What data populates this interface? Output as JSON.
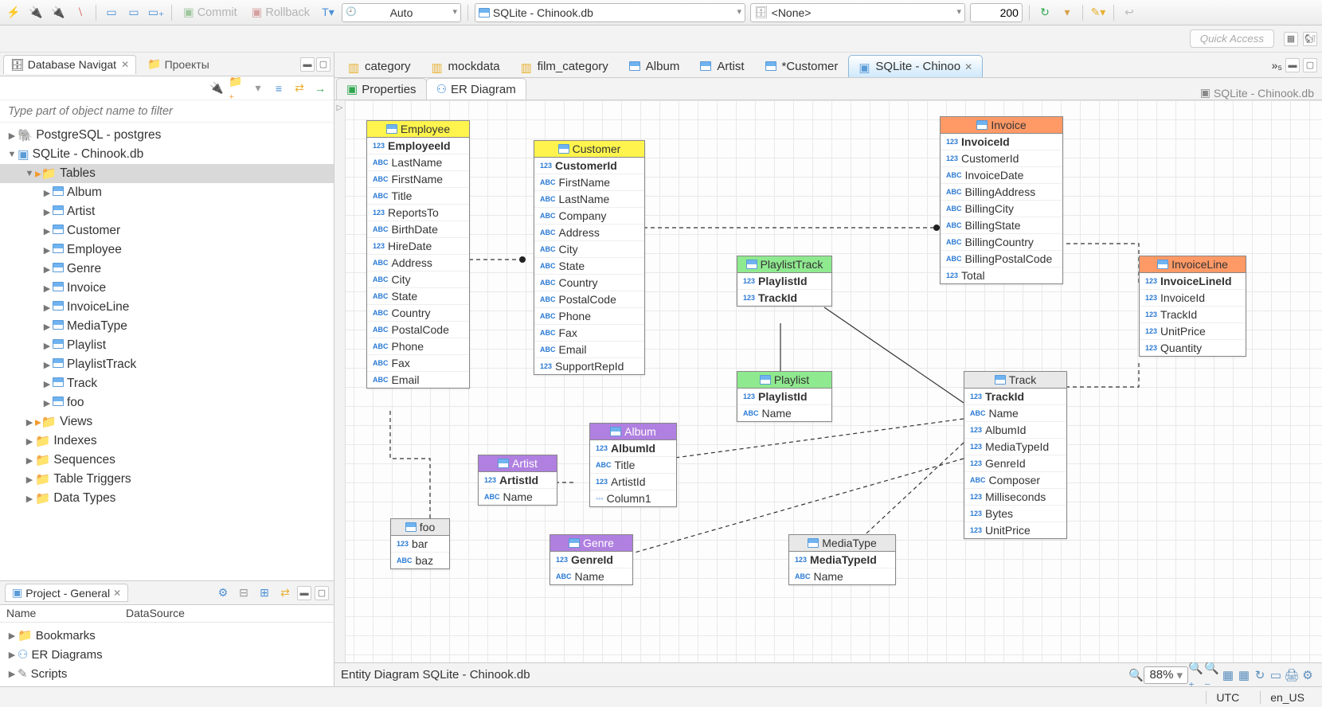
{
  "toolbar": {
    "commit_label": "Commit",
    "rollback_label": "Rollback",
    "mode_label": "Auto",
    "conn1": "SQLite - Chinook.db",
    "conn2": "<None>",
    "rows": "200"
  },
  "quick_access": "Quick Access",
  "nav": {
    "tab1": "Database Navigat",
    "tab2": "Проекты",
    "filter_placeholder": "Type part of object name to filter",
    "tree": [
      {
        "d": 0,
        "exp": "▶",
        "icon": "pg",
        "label": "PostgreSQL - postgres"
      },
      {
        "d": 0,
        "exp": "▼",
        "icon": "sqlite",
        "label": "SQLite - Chinook.db"
      },
      {
        "d": 1,
        "exp": "▼",
        "icon": "folder-o",
        "label": "Tables",
        "selected": true
      },
      {
        "d": 2,
        "exp": "▶",
        "icon": "table",
        "label": "Album"
      },
      {
        "d": 2,
        "exp": "▶",
        "icon": "table",
        "label": "Artist"
      },
      {
        "d": 2,
        "exp": "▶",
        "icon": "table",
        "label": "Customer"
      },
      {
        "d": 2,
        "exp": "▶",
        "icon": "table",
        "label": "Employee"
      },
      {
        "d": 2,
        "exp": "▶",
        "icon": "table",
        "label": "Genre"
      },
      {
        "d": 2,
        "exp": "▶",
        "icon": "table",
        "label": "Invoice"
      },
      {
        "d": 2,
        "exp": "▶",
        "icon": "table",
        "label": "InvoiceLine"
      },
      {
        "d": 2,
        "exp": "▶",
        "icon": "table",
        "label": "MediaType"
      },
      {
        "d": 2,
        "exp": "▶",
        "icon": "table",
        "label": "Playlist"
      },
      {
        "d": 2,
        "exp": "▶",
        "icon": "table",
        "label": "PlaylistTrack"
      },
      {
        "d": 2,
        "exp": "▶",
        "icon": "table",
        "label": "Track"
      },
      {
        "d": 2,
        "exp": "▶",
        "icon": "table",
        "label": "foo"
      },
      {
        "d": 1,
        "exp": "▶",
        "icon": "folder-o",
        "label": "Views"
      },
      {
        "d": 1,
        "exp": "▶",
        "icon": "folder",
        "label": "Indexes"
      },
      {
        "d": 1,
        "exp": "▶",
        "icon": "folder",
        "label": "Sequences"
      },
      {
        "d": 1,
        "exp": "▶",
        "icon": "folder",
        "label": "Table Triggers"
      },
      {
        "d": 1,
        "exp": "▶",
        "icon": "folder",
        "label": "Data Types"
      }
    ]
  },
  "project": {
    "title": "Project - General",
    "col1": "Name",
    "col2": "DataSource",
    "items": [
      {
        "exp": "▶",
        "icon": "folder",
        "label": "Bookmarks"
      },
      {
        "exp": "▶",
        "icon": "er",
        "label": "ER Diagrams"
      },
      {
        "exp": "▶",
        "icon": "scripts",
        "label": "Scripts"
      }
    ]
  },
  "editor": {
    "tabs": [
      {
        "icon": "col",
        "label": "category"
      },
      {
        "icon": "col",
        "label": "mockdata"
      },
      {
        "icon": "col",
        "label": "film_category"
      },
      {
        "icon": "table",
        "label": "Album"
      },
      {
        "icon": "table",
        "label": "Artist"
      },
      {
        "icon": "table",
        "label": "*Customer"
      },
      {
        "icon": "sqlite",
        "label": "SQLite - Chinoo",
        "active": true
      }
    ],
    "more_tabs": "»₅",
    "sub_properties": "Properties",
    "sub_er": "ER Diagram",
    "crumb": "SQLite - Chinook.db"
  },
  "entities": {
    "employee": {
      "title": "Employee",
      "cols": [
        {
          "t": "num",
          "n": "EmployeeId",
          "pk": true
        },
        {
          "t": "abc",
          "n": "LastName"
        },
        {
          "t": "abc",
          "n": "FirstName"
        },
        {
          "t": "abc",
          "n": "Title"
        },
        {
          "t": "num",
          "n": "ReportsTo"
        },
        {
          "t": "abc",
          "n": "BirthDate"
        },
        {
          "t": "num",
          "n": "HireDate"
        },
        {
          "t": "abc",
          "n": "Address"
        },
        {
          "t": "abc",
          "n": "City"
        },
        {
          "t": "abc",
          "n": "State"
        },
        {
          "t": "abc",
          "n": "Country"
        },
        {
          "t": "abc",
          "n": "PostalCode"
        },
        {
          "t": "abc",
          "n": "Phone"
        },
        {
          "t": "abc",
          "n": "Fax"
        },
        {
          "t": "abc",
          "n": "Email"
        }
      ]
    },
    "customer": {
      "title": "Customer",
      "cols": [
        {
          "t": "num",
          "n": "CustomerId",
          "pk": true
        },
        {
          "t": "abc",
          "n": "FirstName"
        },
        {
          "t": "abc",
          "n": "LastName"
        },
        {
          "t": "abc",
          "n": "Company"
        },
        {
          "t": "abc",
          "n": "Address"
        },
        {
          "t": "abc",
          "n": "City"
        },
        {
          "t": "abc",
          "n": "State"
        },
        {
          "t": "abc",
          "n": "Country"
        },
        {
          "t": "abc",
          "n": "PostalCode"
        },
        {
          "t": "abc",
          "n": "Phone"
        },
        {
          "t": "abc",
          "n": "Fax"
        },
        {
          "t": "abc",
          "n": "Email"
        },
        {
          "t": "num",
          "n": "SupportRepId"
        }
      ]
    },
    "invoice": {
      "title": "Invoice",
      "cols": [
        {
          "t": "num",
          "n": "InvoiceId",
          "pk": true
        },
        {
          "t": "num",
          "n": "CustomerId"
        },
        {
          "t": "abc",
          "n": "InvoiceDate"
        },
        {
          "t": "abc",
          "n": "BillingAddress"
        },
        {
          "t": "abc",
          "n": "BillingCity"
        },
        {
          "t": "abc",
          "n": "BillingState"
        },
        {
          "t": "abc",
          "n": "BillingCountry"
        },
        {
          "t": "abc",
          "n": "BillingPostalCode"
        },
        {
          "t": "num",
          "n": "Total"
        }
      ]
    },
    "invoiceline": {
      "title": "InvoiceLine",
      "cols": [
        {
          "t": "num",
          "n": "InvoiceLineId",
          "pk": true
        },
        {
          "t": "num",
          "n": "InvoiceId"
        },
        {
          "t": "num",
          "n": "TrackId"
        },
        {
          "t": "num",
          "n": "UnitPrice"
        },
        {
          "t": "num",
          "n": "Quantity"
        }
      ]
    },
    "playlisttrack": {
      "title": "PlaylistTrack",
      "cols": [
        {
          "t": "num",
          "n": "PlaylistId",
          "pk": true
        },
        {
          "t": "num",
          "n": "TrackId",
          "pk": true
        }
      ]
    },
    "playlist": {
      "title": "Playlist",
      "cols": [
        {
          "t": "num",
          "n": "PlaylistId",
          "pk": true
        },
        {
          "t": "abc",
          "n": "Name"
        }
      ]
    },
    "track": {
      "title": "Track",
      "cols": [
        {
          "t": "num",
          "n": "TrackId",
          "pk": true
        },
        {
          "t": "abc",
          "n": "Name"
        },
        {
          "t": "num",
          "n": "AlbumId"
        },
        {
          "t": "num",
          "n": "MediaTypeId"
        },
        {
          "t": "num",
          "n": "GenreId"
        },
        {
          "t": "abc",
          "n": "Composer"
        },
        {
          "t": "num",
          "n": "Milliseconds"
        },
        {
          "t": "num",
          "n": "Bytes"
        },
        {
          "t": "num",
          "n": "UnitPrice"
        }
      ]
    },
    "album": {
      "title": "Album",
      "cols": [
        {
          "t": "num",
          "n": "AlbumId",
          "pk": true
        },
        {
          "t": "abc",
          "n": "Title"
        },
        {
          "t": "num",
          "n": "ArtistId"
        },
        {
          "t": "oth",
          "n": "Column1"
        }
      ]
    },
    "artist": {
      "title": "Artist",
      "cols": [
        {
          "t": "num",
          "n": "ArtistId",
          "pk": true
        },
        {
          "t": "abc",
          "n": "Name"
        }
      ]
    },
    "genre": {
      "title": "Genre",
      "cols": [
        {
          "t": "num",
          "n": "GenreId",
          "pk": true
        },
        {
          "t": "abc",
          "n": "Name"
        }
      ]
    },
    "mediatype": {
      "title": "MediaType",
      "cols": [
        {
          "t": "num",
          "n": "MediaTypeId",
          "pk": true
        },
        {
          "t": "abc",
          "n": "Name"
        }
      ]
    },
    "foo": {
      "title": "foo",
      "cols": [
        {
          "t": "num",
          "n": "bar"
        },
        {
          "t": "abc",
          "n": "baz"
        }
      ]
    }
  },
  "footer": {
    "title": "Entity Diagram SQLite - Chinook.db",
    "zoom": "88%"
  },
  "status": {
    "tz": "UTC",
    "locale": "en_US"
  }
}
